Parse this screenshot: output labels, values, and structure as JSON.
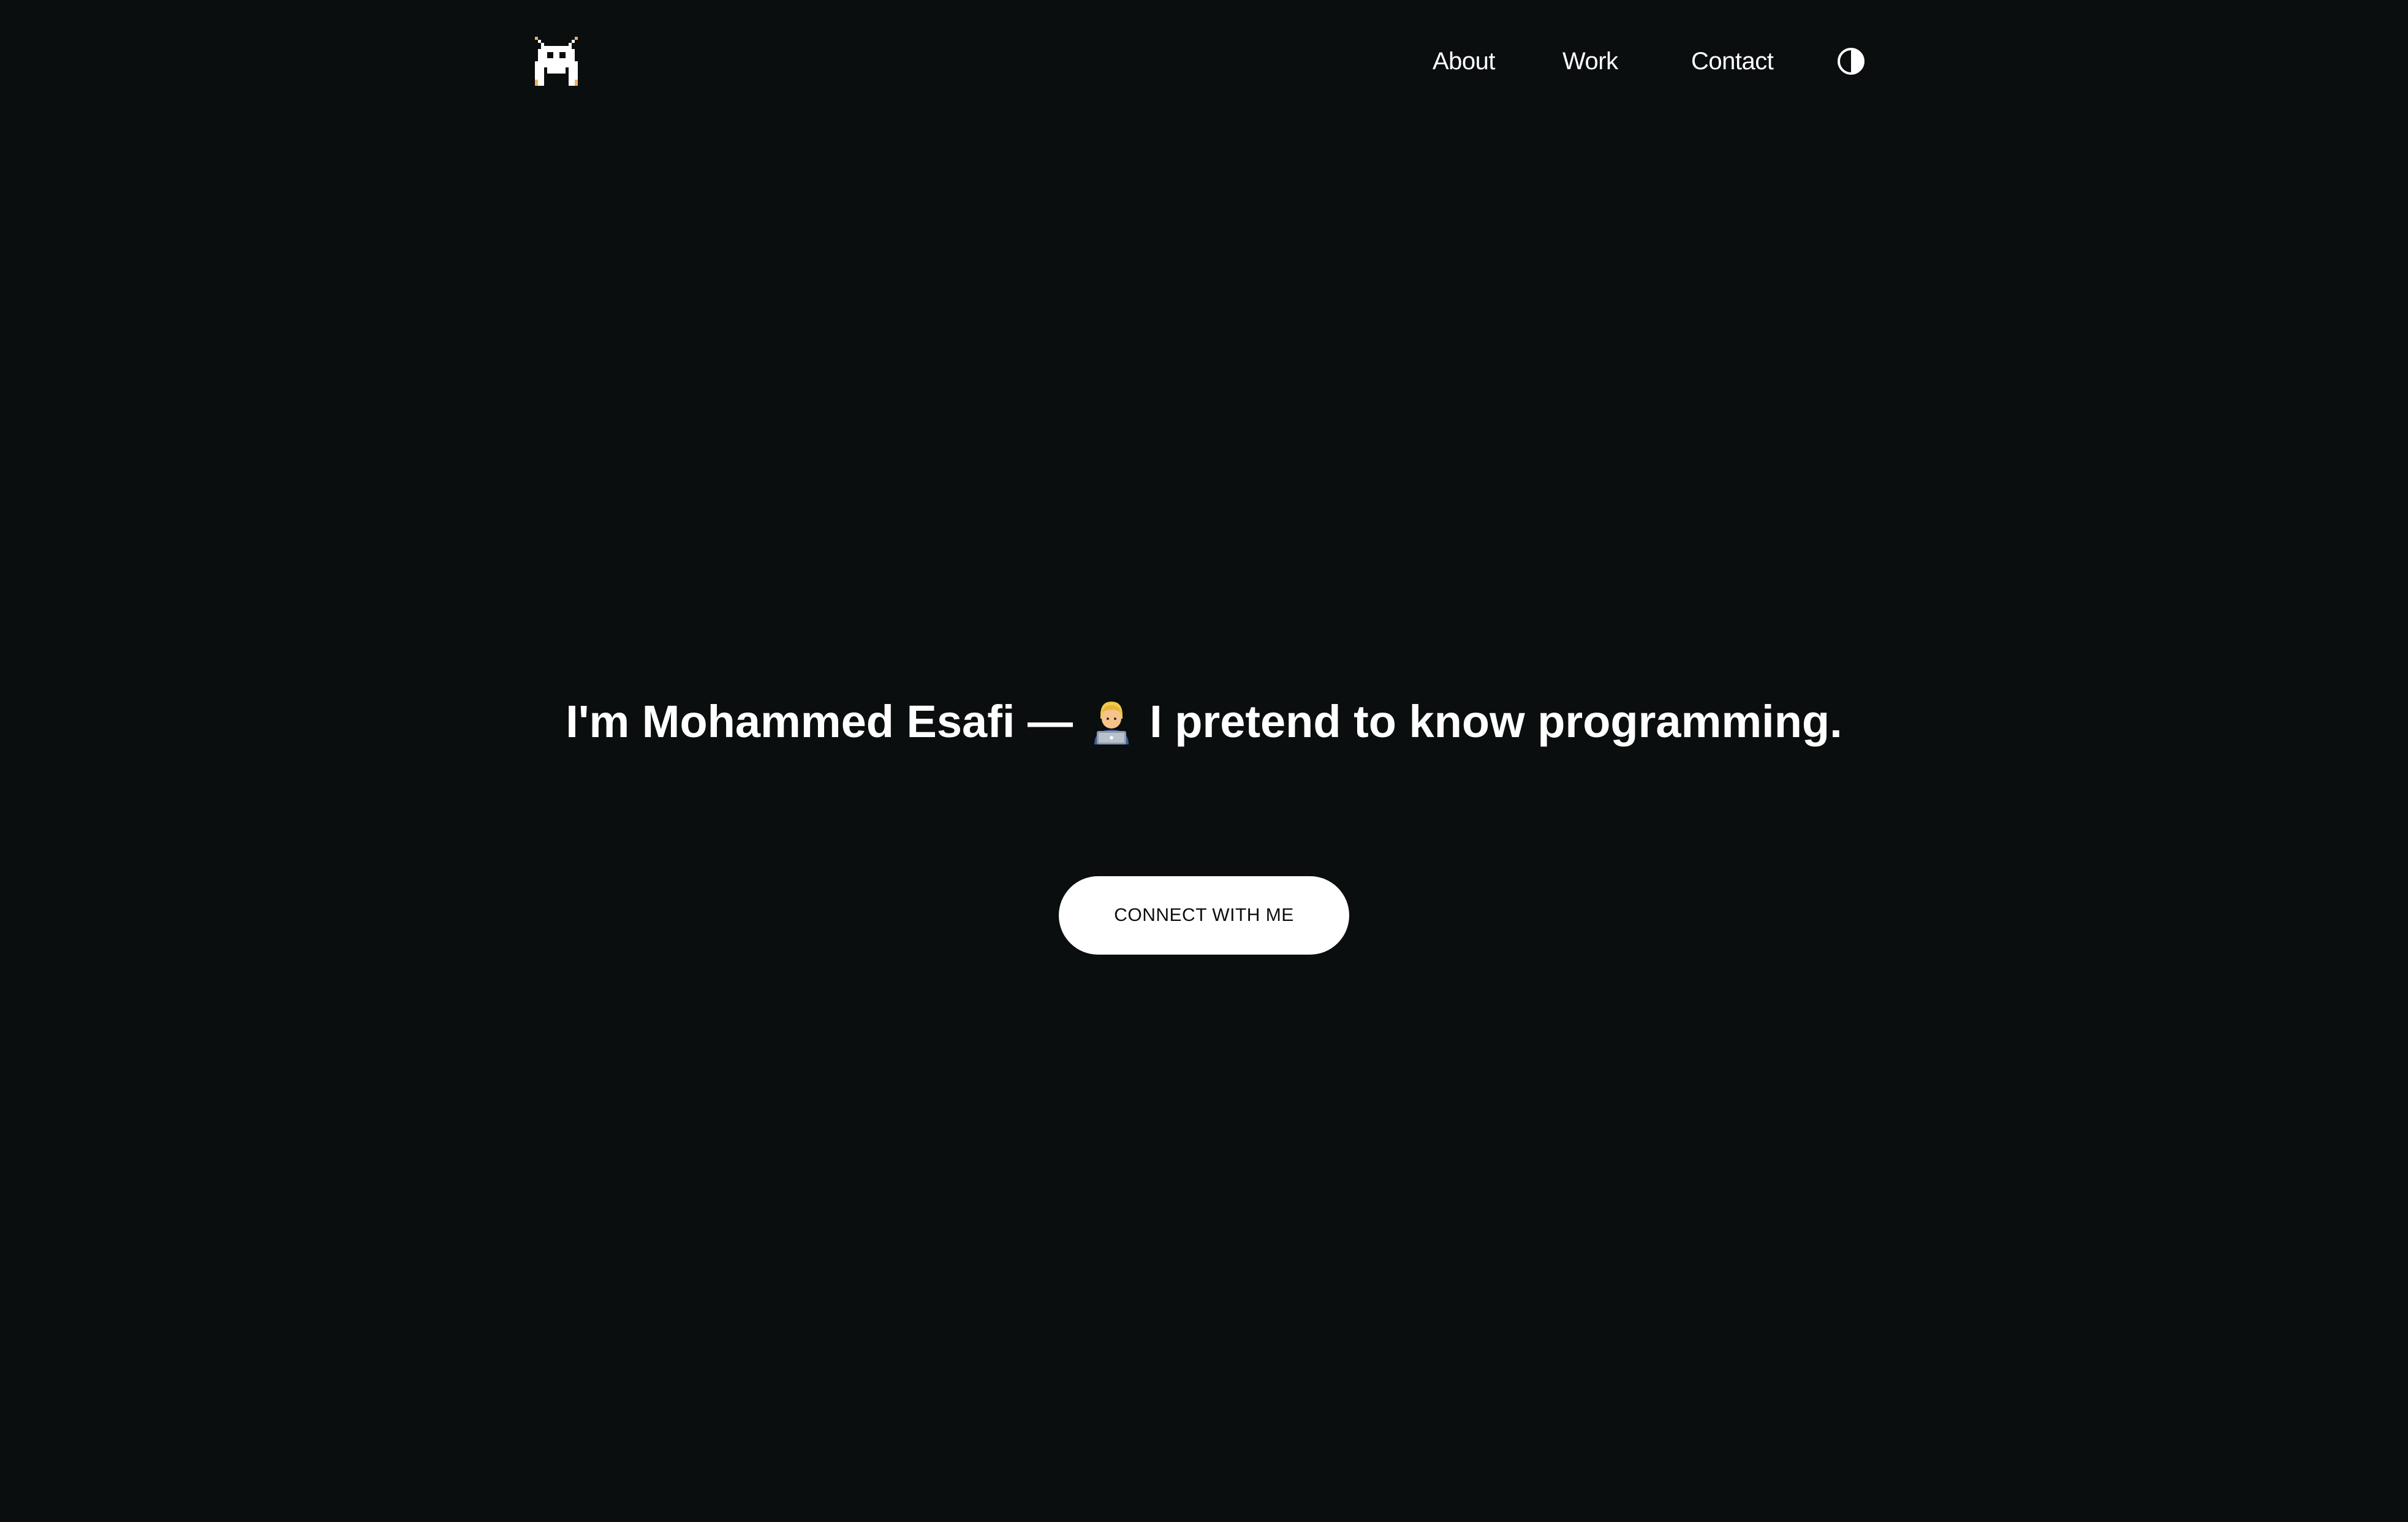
{
  "nav": {
    "logo_icon": "pixel-space-invader-icon",
    "links": [
      {
        "label": "About"
      },
      {
        "label": "Work"
      },
      {
        "label": "Contact"
      }
    ],
    "theme_toggle_icon": "contrast-half-circle-icon"
  },
  "hero": {
    "title_before": "I'm Mohammed Esafi —",
    "emoji_icon": "technologist-emoji-icon",
    "title_after": "I pretend to know programming.",
    "cta_label": "CONNECT WITH ME"
  },
  "colors": {
    "background": "#0b0e0e",
    "text": "#ffffff",
    "button_bg": "#ffffff",
    "button_text": "#0b0e0e",
    "logo_accent": "#f0b060"
  }
}
